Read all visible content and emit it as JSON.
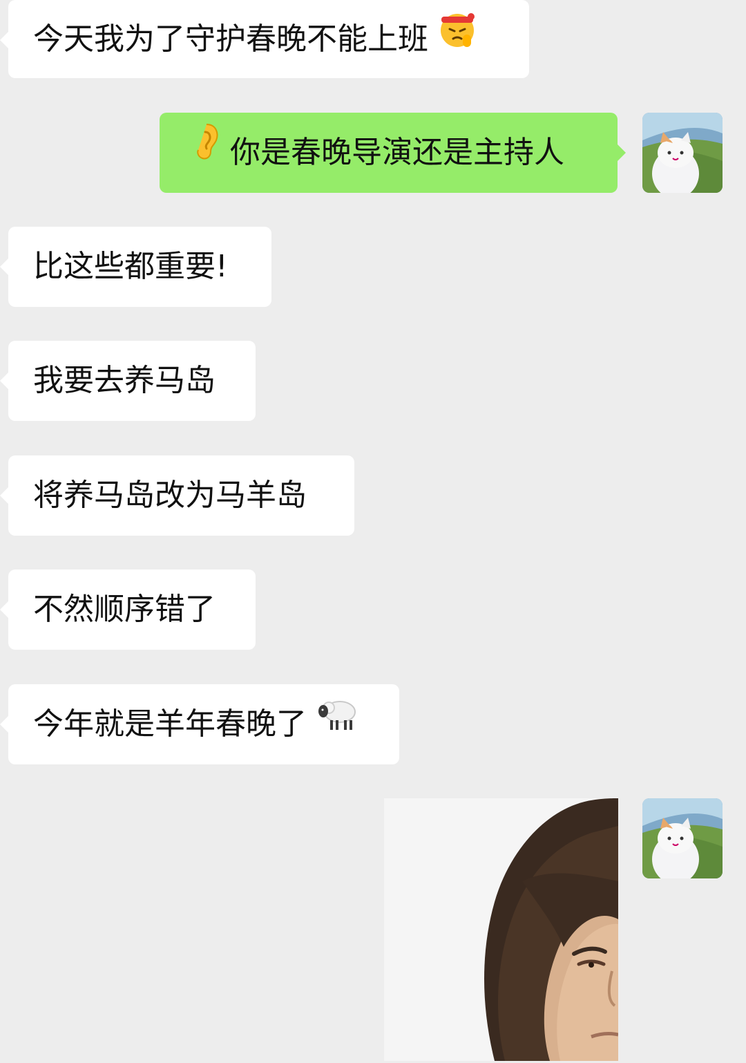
{
  "messages": [
    {
      "side": "in",
      "text": "今天我为了守护春晚不能上班",
      "emoji": "saluting-face-with-headband-icon"
    },
    {
      "side": "out",
      "text": "你是春晚导演还是主持人",
      "emoji": "ear-icon"
    },
    {
      "side": "in",
      "text": "比这些都重要!"
    },
    {
      "side": "in",
      "text": "我要去养马岛"
    },
    {
      "side": "in",
      "text": "将养马岛改为马羊岛"
    },
    {
      "side": "in",
      "text": "不然顺序错了"
    },
    {
      "side": "in",
      "text": "今年就是羊年春晚了",
      "emoji": "sheep-icon"
    },
    {
      "side": "out",
      "type": "image",
      "content": "photo-of-long-haired-man-frowning"
    }
  ],
  "colors": {
    "background": "#ededed",
    "incoming_bubble": "#ffffff",
    "outgoing_bubble": "#95ec69",
    "text": "#111111"
  },
  "avatar": {
    "icon": "cat-avatar-icon"
  }
}
